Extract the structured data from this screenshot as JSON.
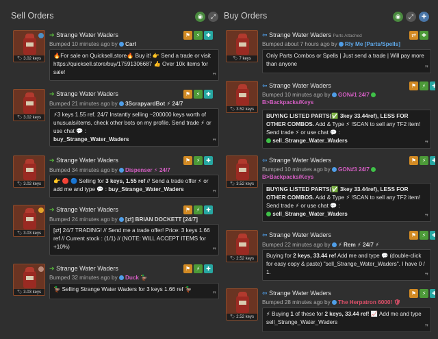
{
  "sell": {
    "title": "Sell Orders",
    "listings": [
      {
        "name": "Strange Water Waders",
        "price": "3.02 keys",
        "time": "Bumped 10 minutes ago by",
        "user": "Carl",
        "message": "🔥For sale on Quicksell.store🔥 Buy it! 👉 Send a trade or visit https://quicksell.store/buy/17591306687 👍 Over 10k items for sale!"
      },
      {
        "name": "Strange Water Waders",
        "price": "3.02 keys",
        "time": "Bumped 21 minutes ago by",
        "user": "3ScrapyardBot ⚡ 24/7",
        "message_a": "⚡3 keys 1.55 ref. 24/7 Instantly selling ~200000 keys worth of unusuals/items, check other bots on my profile. Send  trade ⚡ or  use  chat 💬 :",
        "message_b": "buy_Strange_Water_Waders"
      },
      {
        "name": "Strange Water Waders",
        "price": "3.02 keys",
        "time": "Bumped 34 minutes ago by",
        "user": "Dispenser ⚡ 24/7",
        "message_a": "👉 🔴 🔵  Selling for",
        "message_b": "3 keys, 1.55 ref",
        "message_c": "// Send a trade offer ⚡ or add me and type 💬 :",
        "message_d": "buy_Strange_Water_Waders"
      },
      {
        "name": "Strange Water Waders",
        "price": "3.03 keys",
        "time": "Bumped 24 minutes ago by",
        "user": "[⇄] BRIAN DOCKETT [24/7]",
        "message": "[⇄] 24/7 TRADING! // Send me a trade offer! Price: 3 keys 1.66 ref // Current stock : (1/1) // (NOTE: WILL ACCEPT ITEMS for +10%)"
      },
      {
        "name": "Strange Water Waders",
        "price": "3.03 keys",
        "time": "Bumped 32 minutes ago by",
        "user": "Duck 🦆",
        "message": "🦆 Selling Strange Water Waders for 3 keys 1.66 ref 🦆"
      }
    ]
  },
  "buy": {
    "title": "Buy Orders",
    "listings": [
      {
        "name": "Strange Water Waders",
        "tag": "Parts Attached",
        "price": "7 keys",
        "time": "Bumped about 7 hours ago by",
        "user": "Rly Me [Parts/Spells]",
        "message": "Only Parts Combos or Spells | Just send a trade | Will pay more than anyone"
      },
      {
        "name": "Strange Water Waders",
        "price": "3.52 keys",
        "time": "Bumped 10 minutes ago by",
        "user": "GON#1 24/7",
        "sub2": "B>Backpacks/Keys",
        "message_a": "BUYING LISTED PARTS(✅ 3key 33.44ref), LESS FOR OTHER COMBOS.",
        "message_b": "Add & Type ⚡ !SCAN to sell any TF2 item! Send trade ⚡ or  use  chat 💬 :",
        "message_c": "sell_Strange_Water_Waders"
      },
      {
        "name": "Strange Water Waders",
        "price": "3.52 keys",
        "time": "Bumped 10 minutes ago by",
        "user": "GON#3 24/7",
        "sub2": "B>Backpacks/Keys",
        "message_a": "BUYING LISTED PARTS(✅ 3key 33.44ref), LESS FOR OTHER COMBOS.",
        "message_b": "Add & Type ⚡ !SCAN to sell any TF2 item! Send trade ⚡ or  use  chat 💬 :",
        "message_c": "sell_Strange_Water_Waders"
      },
      {
        "name": "Strange Water Waders",
        "price": "2.52 keys",
        "time": "Bumped 22 minutes ago by",
        "user": "⚡ Rem ⚡ 24/7 ⚡",
        "message_a": "Buying for",
        "message_b": "2 keys, 33.44 ref",
        "message_c": "Add me and type 💬 (double-click for easy copy & paste) \"sell_Strange_Water_Waders\". I have 0 / 1."
      },
      {
        "name": "Strange Water Waders",
        "price": "2.52 keys",
        "time": "Bumped 28 minutes ago by",
        "user": "The Herpatron 6000! 🛡",
        "message_a": "⚡ Buying",
        "message_b": "1",
        "message_c": "of these for",
        "message_d": "2 keys, 33.44 ref",
        "message_e": "! 📈 Add me and type sell_Strange_Water_Waders"
      }
    ]
  }
}
